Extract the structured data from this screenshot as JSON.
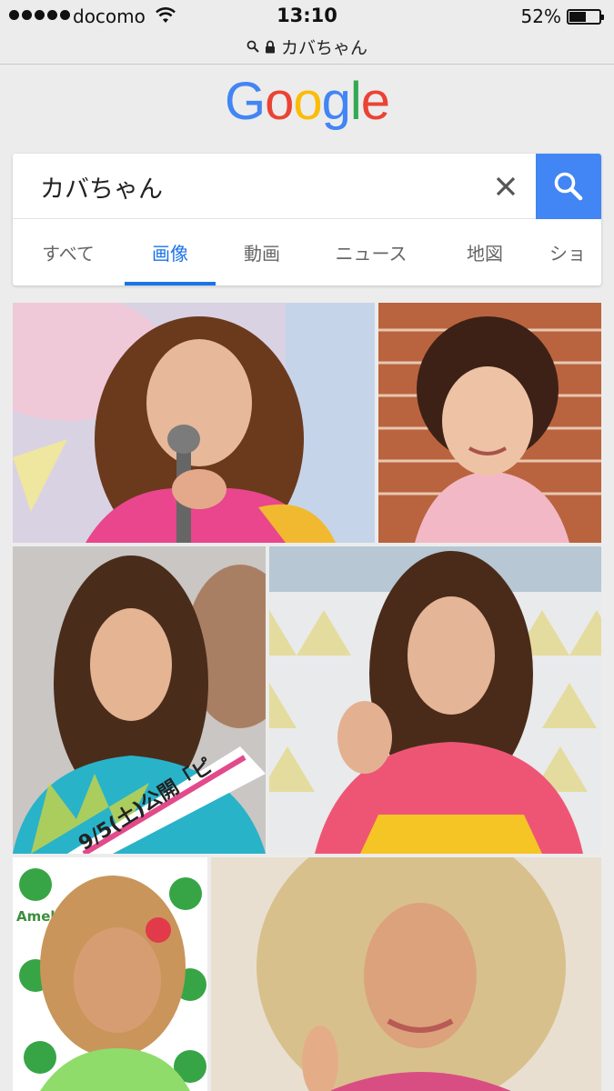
{
  "status_bar": {
    "carrier": "docomo",
    "time": "13:10",
    "battery": "52%"
  },
  "address_bar": {
    "text": "カバちゃん"
  },
  "logo": {
    "letters": [
      "G",
      "o",
      "o",
      "g",
      "l",
      "e"
    ],
    "colors": [
      "#4285F4",
      "#EA4335",
      "#FBBC05",
      "#4285F4",
      "#34A853",
      "#EA4335"
    ]
  },
  "search": {
    "value": "カバちゃん"
  },
  "tabs": [
    {
      "label": "すべて"
    },
    {
      "label": "画像"
    },
    {
      "label": "動画"
    },
    {
      "label": "ニュース"
    },
    {
      "label": "地図"
    },
    {
      "label": "ショ"
    }
  ],
  "active_tab": "画像",
  "accent_color": "#4285F4",
  "image_results": [
    {
      "overlay_text": ""
    },
    {
      "overlay_text": ""
    },
    {
      "overlay_text": "9/5(土)公開「ピ"
    },
    {
      "overlay_text": ""
    },
    {
      "overlay_text": "Ameba"
    },
    {
      "overlay_text": ""
    }
  ]
}
